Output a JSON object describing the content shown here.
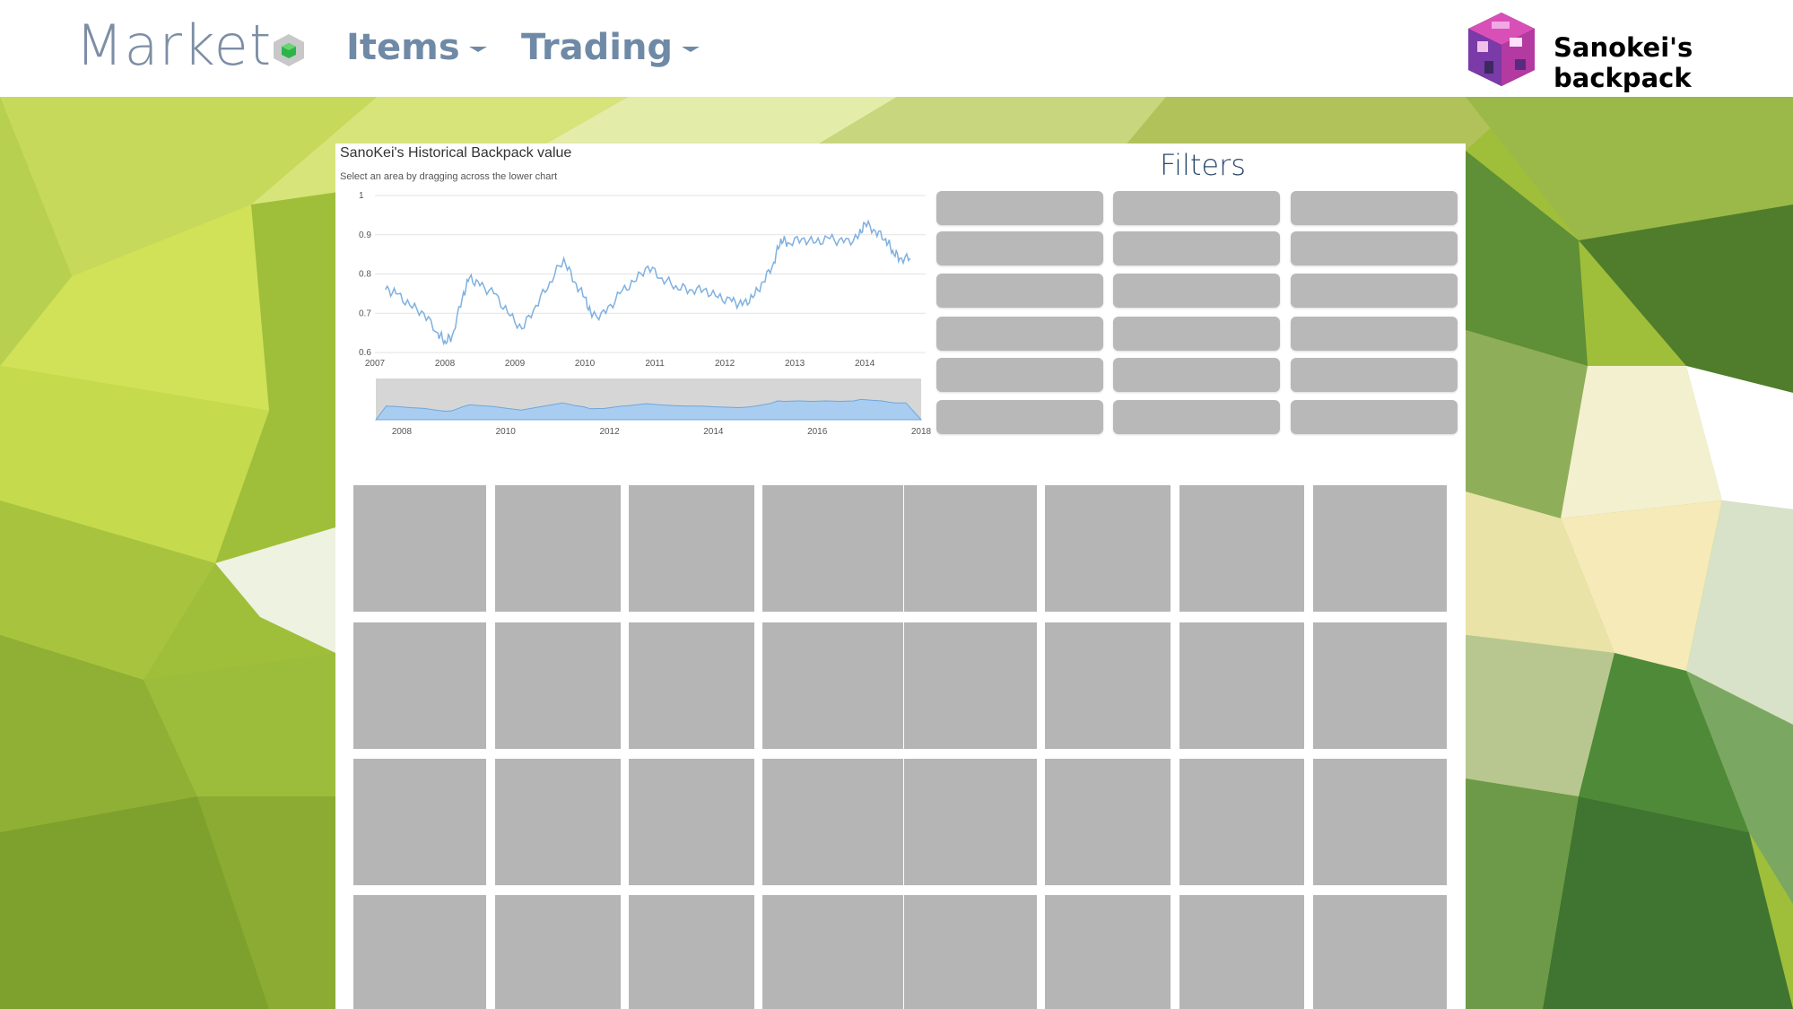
{
  "header": {
    "brand": "Market",
    "nav": [
      {
        "label": "Items"
      },
      {
        "label": "Trading"
      }
    ],
    "user": {
      "name": "Sanokei's backpack"
    }
  },
  "chart": {
    "title": "SanoKei's Historical Backpack value",
    "subtitle": "Select an area by dragging across the lower chart"
  },
  "chart_data": {
    "type": "line",
    "title": "SanoKei's Historical Backpack value",
    "subtitle": "Select an area by dragging across the lower chart",
    "main": {
      "ylim": [
        0.6,
        1
      ],
      "y_ticks": [
        "1",
        "0.9",
        "0.8",
        "0.7",
        "0.6"
      ],
      "x_ticks": [
        "2007",
        "2008",
        "2009",
        "2010",
        "2011",
        "2012",
        "2013",
        "2014"
      ],
      "series": [
        {
          "points": [
            [
              2007.15,
              0.76
            ],
            [
              2007.3,
              0.75
            ],
            [
              2007.5,
              0.72
            ],
            [
              2007.7,
              0.7
            ],
            [
              2007.9,
              0.65
            ],
            [
              2008.0,
              0.63
            ],
            [
              2008.1,
              0.64
            ],
            [
              2008.25,
              0.74
            ],
            [
              2008.35,
              0.79
            ],
            [
              2008.5,
              0.77
            ],
            [
              2008.7,
              0.75
            ],
            [
              2008.9,
              0.7
            ],
            [
              2009.1,
              0.66
            ],
            [
              2009.3,
              0.72
            ],
            [
              2009.5,
              0.78
            ],
            [
              2009.7,
              0.84
            ],
            [
              2009.85,
              0.78
            ],
            [
              2010.0,
              0.74
            ],
            [
              2010.1,
              0.69
            ],
            [
              2010.3,
              0.7
            ],
            [
              2010.5,
              0.75
            ],
            [
              2010.7,
              0.78
            ],
            [
              2010.9,
              0.82
            ],
            [
              2011.1,
              0.79
            ],
            [
              2011.3,
              0.77
            ],
            [
              2011.5,
              0.76
            ],
            [
              2011.7,
              0.76
            ],
            [
              2011.9,
              0.74
            ],
            [
              2012.1,
              0.73
            ],
            [
              2012.25,
              0.72
            ],
            [
              2012.4,
              0.74
            ],
            [
              2012.55,
              0.78
            ],
            [
              2012.7,
              0.83
            ],
            [
              2012.8,
              0.89
            ],
            [
              2012.9,
              0.88
            ],
            [
              2013.1,
              0.89
            ],
            [
              2013.3,
              0.88
            ],
            [
              2013.5,
              0.89
            ],
            [
              2013.7,
              0.88
            ],
            [
              2013.9,
              0.89
            ],
            [
              2014.0,
              0.93
            ],
            [
              2014.15,
              0.91
            ],
            [
              2014.3,
              0.89
            ],
            [
              2014.4,
              0.86
            ],
            [
              2014.5,
              0.84
            ],
            [
              2014.65,
              0.84
            ]
          ]
        }
      ]
    },
    "navigator": {
      "x_ticks": [
        "2008",
        "2010",
        "2012",
        "2014",
        "2016",
        "2018"
      ]
    }
  },
  "filters": {
    "title": "Filters",
    "buttons": [
      "",
      "",
      "",
      "",
      "",
      "",
      "",
      "",
      "",
      "",
      "",
      "",
      "",
      "",
      "",
      "",
      "",
      ""
    ]
  },
  "items": {
    "tiles": [
      "",
      "",
      "",
      "",
      "",
      "",
      "",
      "",
      "",
      "",
      "",
      "",
      "",
      "",
      "",
      "",
      "",
      "",
      "",
      "",
      "",
      "",
      "",
      "",
      "",
      "",
      "",
      "",
      "",
      "",
      "",
      ""
    ]
  },
  "colors": {
    "line": "#7fb1e0",
    "navigator_fill": "#a9cdf0",
    "tile": "#b5b5b5",
    "brand": "#7d8ea5",
    "nav": "#6f8aa6",
    "filters_title": "#2c4a6e"
  }
}
